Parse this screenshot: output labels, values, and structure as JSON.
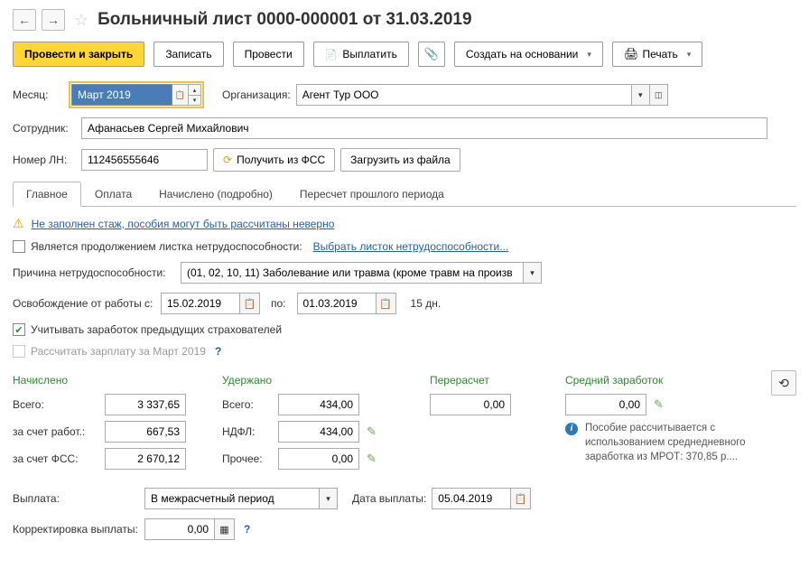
{
  "header": {
    "title": "Больничный лист 0000-000001 от 31.03.2019"
  },
  "toolbar": {
    "submit_close": "Провести и закрыть",
    "save": "Записать",
    "submit": "Провести",
    "pay": "Выплатить",
    "create_based": "Создать на основании",
    "print": "Печать"
  },
  "form": {
    "month_label": "Месяц:",
    "month_value": "Март 2019",
    "org_label": "Организация:",
    "org_value": "Агент Тур ООО",
    "employee_label": "Сотрудник:",
    "employee_value": "Афанасьев Сергей Михайлович",
    "ln_label": "Номер ЛН:",
    "ln_value": "112456555646",
    "get_fss": "Получить из ФСС",
    "load_file": "Загрузить из файла"
  },
  "tabs": {
    "main": "Главное",
    "payment": "Оплата",
    "accrued": "Начислено (подробно)",
    "recalc": "Пересчет прошлого периода"
  },
  "main_tab": {
    "warning": "Не заполнен стаж, пособия могут быть рассчитаны неверно",
    "continuation_label": "Является продолжением листка нетрудоспособности:",
    "select_sheet": "Выбрать листок нетрудоспособности...",
    "reason_label": "Причина нетрудоспособности:",
    "reason_value": "(01, 02, 10, 11) Заболевание или травма (кроме травм на произв",
    "absence_label": "Освобождение от работы с:",
    "date_from": "15.02.2019",
    "date_to_label": "по:",
    "date_to": "01.03.2019",
    "days": "15 дн.",
    "consider_prev": "Учитывать заработок предыдущих страхователей",
    "calc_salary": "Рассчитать зарплату за Март 2019"
  },
  "calc": {
    "accrued_header": "Начислено",
    "deducted_header": "Удержано",
    "recalc_header": "Перерасчет",
    "avg_header": "Средний заработок",
    "total_label": "Всего:",
    "total_accrued": "3 337,65",
    "total_deducted": "434,00",
    "recalc_value": "0,00",
    "avg_value": "0,00",
    "employer_label": "за счет работ.:",
    "employer_value": "667,53",
    "fss_label": "за счет ФСС:",
    "fss_value": "2 670,12",
    "ndfl_label": "НДФЛ:",
    "ndfl_value": "434,00",
    "other_label": "Прочее:",
    "other_value": "0,00",
    "info_text": "Пособие рассчитывается с использованием среднедневного заработка из МРОТ: 370,85 р...."
  },
  "payout": {
    "label": "Выплата:",
    "value": "В межрасчетный период",
    "date_label": "Дата выплаты:",
    "date_value": "05.04.2019",
    "correction_label": "Корректировка выплаты:",
    "correction_value": "0,00"
  }
}
